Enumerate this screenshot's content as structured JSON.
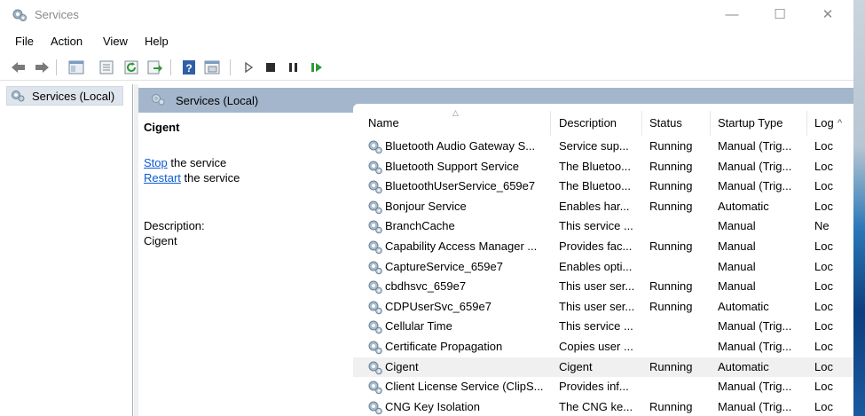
{
  "window": {
    "title": "Services",
    "minimize": "—",
    "maximize": "☐",
    "close": "✕"
  },
  "menu": [
    "File",
    "Action",
    "View",
    "Help"
  ],
  "toolbar_icons": [
    "back-icon",
    "forward-icon",
    "show-hide-console-tree-icon",
    "properties-icon",
    "refresh-icon",
    "export-list-icon",
    "help-icon",
    "console-view-icon",
    "start-service-icon",
    "stop-service-icon",
    "pause-service-icon",
    "resume-service-icon"
  ],
  "tree": {
    "label": "Services (Local)"
  },
  "header": {
    "title": "Services (Local)"
  },
  "detail": {
    "service_name": "Cigent",
    "stop_link": "Stop",
    "stop_rest": " the service",
    "restart_link": "Restart",
    "restart_rest": " the service",
    "description_label": "Description:",
    "description_value": "Cigent"
  },
  "columns": [
    "Name",
    "Description",
    "Status",
    "Startup Type",
    "Log"
  ],
  "rows": [
    {
      "name": "Bluetooth Audio Gateway S...",
      "description": "Service sup...",
      "status": "Running",
      "startup": "Manual (Trig...",
      "logon": "Loc"
    },
    {
      "name": "Bluetooth Support Service",
      "description": "The Bluetoo...",
      "status": "Running",
      "startup": "Manual (Trig...",
      "logon": "Loc"
    },
    {
      "name": "BluetoothUserService_659e7",
      "description": "The Bluetoo...",
      "status": "Running",
      "startup": "Manual (Trig...",
      "logon": "Loc"
    },
    {
      "name": "Bonjour Service",
      "description": "Enables har...",
      "status": "Running",
      "startup": "Automatic",
      "logon": "Loc"
    },
    {
      "name": "BranchCache",
      "description": "This service ...",
      "status": "",
      "startup": "Manual",
      "logon": "Ne"
    },
    {
      "name": "Capability Access Manager ...",
      "description": "Provides fac...",
      "status": "Running",
      "startup": "Manual",
      "logon": "Loc"
    },
    {
      "name": "CaptureService_659e7",
      "description": "Enables opti...",
      "status": "",
      "startup": "Manual",
      "logon": "Loc"
    },
    {
      "name": "cbdhsvc_659e7",
      "description": "This user ser...",
      "status": "Running",
      "startup": "Manual",
      "logon": "Loc"
    },
    {
      "name": "CDPUserSvc_659e7",
      "description": "This user ser...",
      "status": "Running",
      "startup": "Automatic",
      "logon": "Loc"
    },
    {
      "name": "Cellular Time",
      "description": "This service ...",
      "status": "",
      "startup": "Manual (Trig...",
      "logon": "Loc"
    },
    {
      "name": "Certificate Propagation",
      "description": "Copies user ...",
      "status": "",
      "startup": "Manual (Trig...",
      "logon": "Loc"
    },
    {
      "name": "Cigent",
      "description": "Cigent",
      "status": "Running",
      "startup": "Automatic",
      "logon": "Loc",
      "selected": true
    },
    {
      "name": "Client License Service (ClipS...",
      "description": "Provides inf...",
      "status": "",
      "startup": "Manual (Trig...",
      "logon": "Loc"
    },
    {
      "name": "CNG Key Isolation",
      "description": "The CNG ke...",
      "status": "Running",
      "startup": "Manual (Trig...",
      "logon": "Loc"
    }
  ],
  "colors": {
    "header_band": "#a3b6cc",
    "link": "#0b5cd6",
    "selected_row": "#f0f0f0"
  }
}
